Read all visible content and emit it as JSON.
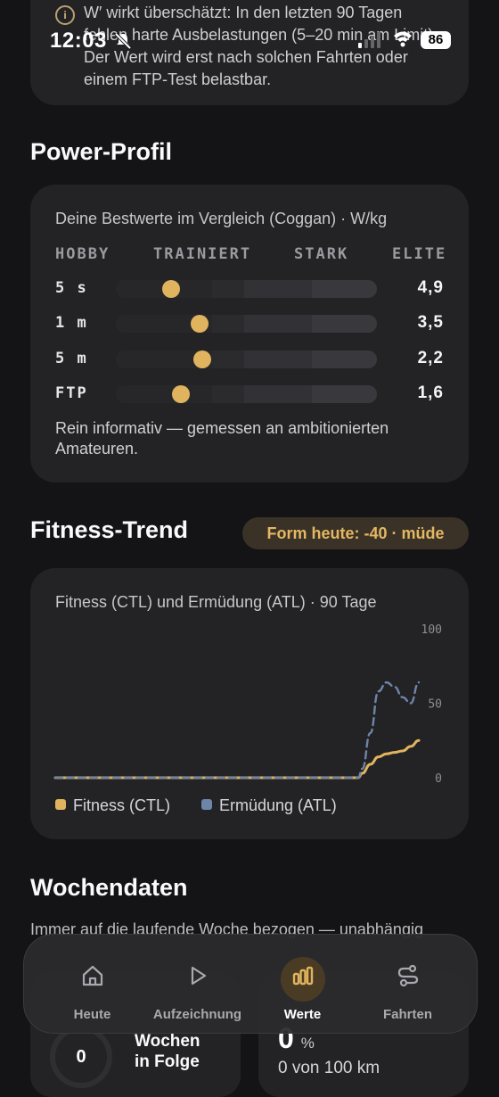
{
  "status_bar": {
    "time": "12:03",
    "battery": "86"
  },
  "warning": {
    "text": "W′ wirkt überschätzt: In den letzten 90 Tagen fehlen harte Ausbelastungen (5–20 min am Limit). Der Wert wird erst nach solchen Fahrten oder einem FTP-Test belastbar.",
    "icon": "info-icon"
  },
  "power_profile": {
    "title": "Power-Profil",
    "subtitle": "Deine Bestwerte im Vergleich (Coggan) · W/kg",
    "levels": [
      "HOBBY",
      "TRAINIERT",
      "STARK",
      "ELITE"
    ],
    "rows": [
      {
        "label": "5 s",
        "value": "4,9",
        "position": 0.21
      },
      {
        "label": "1 m",
        "value": "3,5",
        "position": 0.32
      },
      {
        "label": "5 m",
        "value": "2,2",
        "position": 0.33
      },
      {
        "label": "FTP",
        "value": "1,6",
        "position": 0.25
      }
    ],
    "note": "Rein informativ — gemessen an ambitionierten Amateuren.",
    "colors": {
      "dot": "#e0b45e"
    }
  },
  "fitness_trend": {
    "title": "Fitness-Trend",
    "form_badge": "Form heute: -40 · müde",
    "subtitle": "Fitness (CTL) und Ermüdung (ATL) · 90 Tage",
    "legend": {
      "ctl": "Fitness (CTL)",
      "atl": "Ermüdung (ATL)"
    },
    "colors": {
      "ctl": "#e0b45e",
      "atl": "#6d86a8"
    }
  },
  "chart_data": {
    "type": "line",
    "title": "Fitness (CTL) und Ermüdung (ATL) · 90 Tage",
    "xlabel": "",
    "ylabel": "",
    "ylim": [
      0,
      100
    ],
    "y_ticks": [
      "100",
      "50",
      "0"
    ],
    "grid": false,
    "legend_position": "bottom-left",
    "x": [
      0,
      5,
      10,
      15,
      20,
      25,
      30,
      35,
      40,
      45,
      50,
      55,
      60,
      65,
      70,
      75,
      76,
      78,
      80,
      82,
      84,
      86,
      88,
      90
    ],
    "series": [
      {
        "name": "Fitness (CTL)",
        "color": "#e0b45e",
        "dash": false,
        "values": [
          0,
          0,
          0,
          0,
          0,
          0,
          0,
          0,
          0,
          0,
          0,
          0,
          0,
          0,
          0,
          0,
          3,
          9,
          14,
          16,
          17,
          18,
          21,
          25
        ]
      },
      {
        "name": "Ermüdung (ATL)",
        "color": "#6d86a8",
        "dash": true,
        "values": [
          0,
          0,
          0,
          0,
          0,
          0,
          0,
          0,
          0,
          0,
          0,
          0,
          0,
          0,
          0,
          0,
          6,
          30,
          58,
          64,
          61,
          54,
          50,
          64
        ]
      }
    ]
  },
  "wochendaten": {
    "title": "Wochendaten",
    "description": "Immer auf die laufende Woche bezogen — unabhängig",
    "streak_value": "0",
    "streak_label_line1": "Wochen",
    "streak_label_line2": "in Folge",
    "progress_value": "0",
    "progress_unit": "%",
    "progress_text": "0 von 100 km"
  },
  "nav": {
    "items": [
      {
        "label": "Heute",
        "icon": "home-icon",
        "active": false
      },
      {
        "label": "Aufzeichnung",
        "icon": "play-icon",
        "active": false
      },
      {
        "label": "Werte",
        "icon": "chart-bars-icon",
        "active": true
      },
      {
        "label": "Fahrten",
        "icon": "route-icon",
        "active": false
      }
    ]
  }
}
